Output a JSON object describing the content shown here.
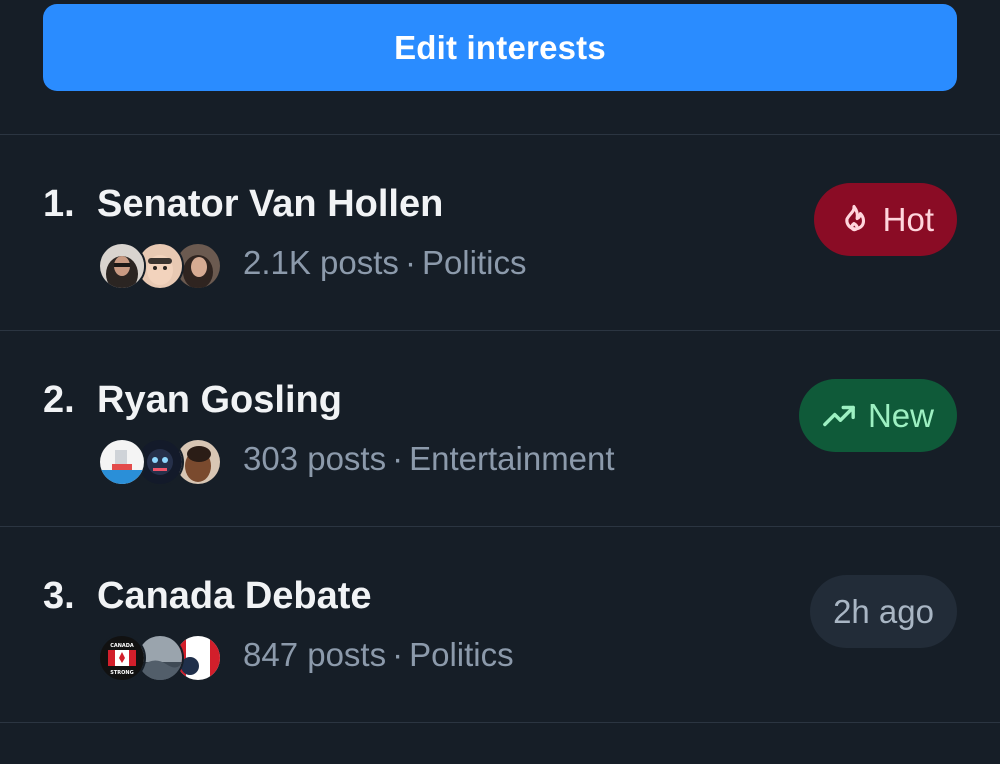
{
  "edit_button": {
    "label": "Edit interests"
  },
  "trends": [
    {
      "rank": "1.",
      "topic": "Senator Van Hollen",
      "posts": "2.1K posts",
      "category": "Politics",
      "separator": "·",
      "badge": {
        "label": "Hot",
        "icon": "flame-icon",
        "color": "#8a0c25"
      }
    },
    {
      "rank": "2.",
      "topic": "Ryan Gosling",
      "posts": "303 posts",
      "category": "Entertainment",
      "separator": "·",
      "badge": {
        "label": "New",
        "icon": "trending-up-icon",
        "color": "#0f5a39"
      }
    },
    {
      "rank": "3.",
      "topic": "Canada Debate",
      "posts": "847 posts",
      "category": "Politics",
      "separator": "·",
      "badge": {
        "label": "2h ago",
        "icon": "",
        "color": "#222c38"
      }
    }
  ],
  "avatar_badge_text": {
    "canada_top": "CANADA",
    "canada_bottom": "STRONG"
  }
}
